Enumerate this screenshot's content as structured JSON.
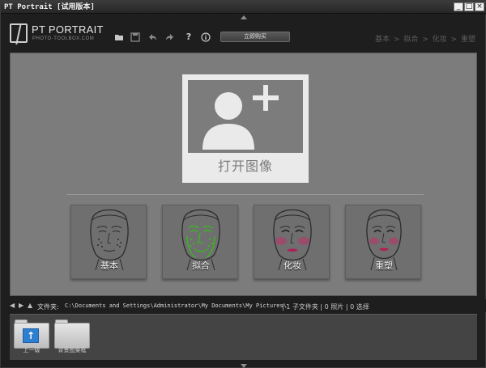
{
  "window": {
    "title": "PT Portrait [试用版本]",
    "minimize_label": "_",
    "maximize_label": "□",
    "close_label": "×"
  },
  "header": {
    "logo_title": "PT PORTRAIT",
    "logo_subtitle": "PHOTO-TOOLBOX.COM",
    "buy_button": "立即购买",
    "tools": [
      {
        "icon": "folder-open-icon",
        "glyph": "▬"
      },
      {
        "icon": "save-icon",
        "glyph": "▣"
      },
      {
        "icon": "undo-icon",
        "glyph": "↶"
      },
      {
        "icon": "redo-icon",
        "glyph": "↷"
      },
      {
        "icon": "help-icon",
        "glyph": "?"
      },
      {
        "icon": "info-icon",
        "glyph": "ⓘ"
      }
    ],
    "breadcrumbs": [
      "基本",
      ">",
      "拟合",
      ">",
      "化妆",
      ">",
      "重塑"
    ]
  },
  "canvas": {
    "open_image_label": "打开图像",
    "steps": [
      {
        "label": "基本",
        "icon": "face-basic-icon"
      },
      {
        "label": "拟合",
        "icon": "face-fit-icon"
      },
      {
        "label": "化妆",
        "icon": "face-makeup-icon"
      },
      {
        "label": "重塑",
        "icon": "face-reshape-icon"
      }
    ]
  },
  "pathbar": {
    "folder_label": "文件夹:",
    "path": "C:\\Documents and Settings\\Administrator\\My Documents\\My Pictures\\",
    "subfolders": "| 1 子文件夹",
    "photos": "| 0 照片",
    "selected": "| 0 选择"
  },
  "browser": {
    "items": [
      {
        "label": "上一级",
        "icon": "up-folder-icon"
      },
      {
        "label": "背景图案框",
        "icon": "folder-icon"
      }
    ]
  },
  "colors": {
    "canvas_bg": "#7c7c7c",
    "app_bg": "#1e1e1e",
    "accent_blue": "#2f7fd1",
    "fit_points": "#3fae2a",
    "makeup_blush": "#c0306a"
  }
}
